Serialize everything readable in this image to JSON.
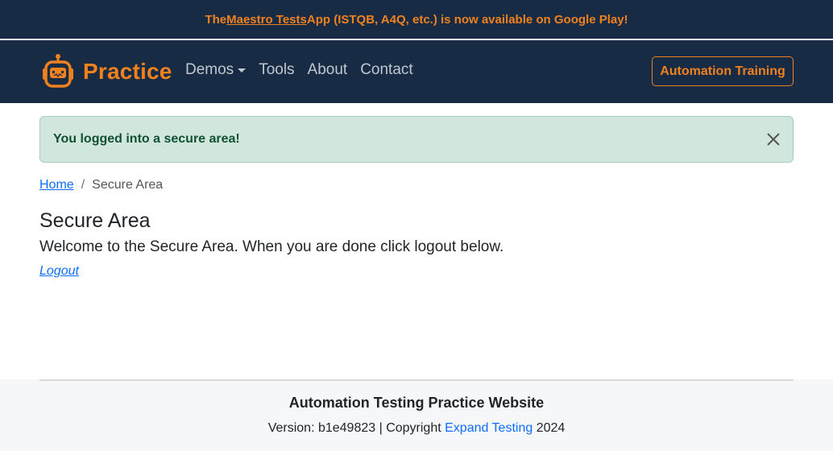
{
  "promo": {
    "before": "The ",
    "link": "Maestro Tests",
    "after": " App (ISTQB, A4Q, etc.) is now available on Google Play!"
  },
  "nav": {
    "brand": "Practice",
    "links": [
      "Demos",
      "Tools",
      "About",
      "Contact"
    ],
    "cta": "Automation Training"
  },
  "alert": {
    "message": "You logged into a secure area!",
    "close_icon": "close-icon"
  },
  "breadcrumb": {
    "home": "Home",
    "separator": "/",
    "current": "Secure Area"
  },
  "main": {
    "title": "Secure Area",
    "welcome": "Welcome to the Secure Area. When you are done click logout below.",
    "logout": "Logout"
  },
  "footer": {
    "title": "Automation Testing Practice Website",
    "version_prefix": "Version: b1e49823 | Copyright ",
    "company": "Expand Testing",
    "year": " 2024"
  },
  "colors": {
    "navy": "#182b45",
    "accent": "#f0811f",
    "success_bg": "#d1e7dd",
    "success_text": "#0f5132",
    "link": "#0d6efd"
  }
}
